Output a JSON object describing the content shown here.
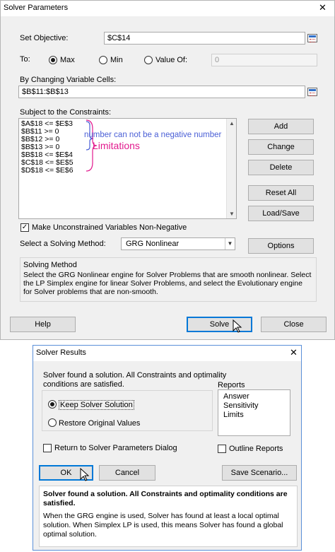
{
  "solver_parameters": {
    "title": "Solver Parameters",
    "close_glyph": "✕",
    "set_objective_label": "Set Objective:",
    "objective_value": "$C$14",
    "to_label": "To:",
    "max_label": "Max",
    "min_label": "Min",
    "value_of_label": "Value Of:",
    "value_of_value": "0",
    "selected_goal": "Max",
    "changing_cells_label": "By Changing Variable Cells:",
    "changing_cells_value": "$B$11:$B$13",
    "constraints_label": "Subject to the Constraints:",
    "constraints": [
      "$A$18 <= $E$3",
      "$B$11 >= 0",
      "$B$12 >= 0",
      "$B$13 >= 0",
      "$B$18 <= $E$4",
      "$C$18 <= $E$5",
      "$D$18 <= $E$6"
    ],
    "annotations": {
      "non_negative_note": "number can not be a negative number",
      "limitations_note": "Limitations",
      "blue_color": "#4a5fd6",
      "magenta_color": "#e21a8e"
    },
    "buttons": {
      "add": "Add",
      "change": "Change",
      "delete": "Delete",
      "reset_all": "Reset All",
      "load_save": "Load/Save",
      "options": "Options",
      "help": "Help",
      "solve": "Solve",
      "close": "Close"
    },
    "make_nonnegative_label": "Make Unconstrained Variables Non-Negative",
    "make_nonnegative_checked": true,
    "solving_method_label": "Select a Solving Method:",
    "solving_method_value": "GRG Nonlinear",
    "solving_method_group_title": "Solving Method",
    "solving_method_description": "Select the GRG Nonlinear engine for Solver Problems that are smooth nonlinear. Select the LP Simplex engine for linear Solver Problems, and select the Evolutionary engine for Solver problems that are non-smooth."
  },
  "solver_results": {
    "title": "Solver Results",
    "close_glyph": "✕",
    "status_message": "Solver found a solution.  All Constraints and optimality conditions are satisfied.",
    "keep_solution_label": "Keep Solver Solution",
    "restore_values_label": "Restore Original Values",
    "selected_option": "Keep Solver Solution",
    "reports_label": "Reports",
    "reports": [
      "Answer",
      "Sensitivity",
      "Limits"
    ],
    "return_to_dialog_label": "Return to Solver Parameters Dialog",
    "outline_reports_label": "Outline Reports",
    "buttons": {
      "ok": "OK",
      "cancel": "Cancel",
      "save_scenario": "Save Scenario..."
    },
    "summary_title": "Solver found a solution.  All Constraints and optimality conditions are satisfied.",
    "summary_body": "When the GRG engine is used, Solver has found at least a local optimal solution. When Simplex LP is used, this means Solver has found a global optimal solution."
  }
}
